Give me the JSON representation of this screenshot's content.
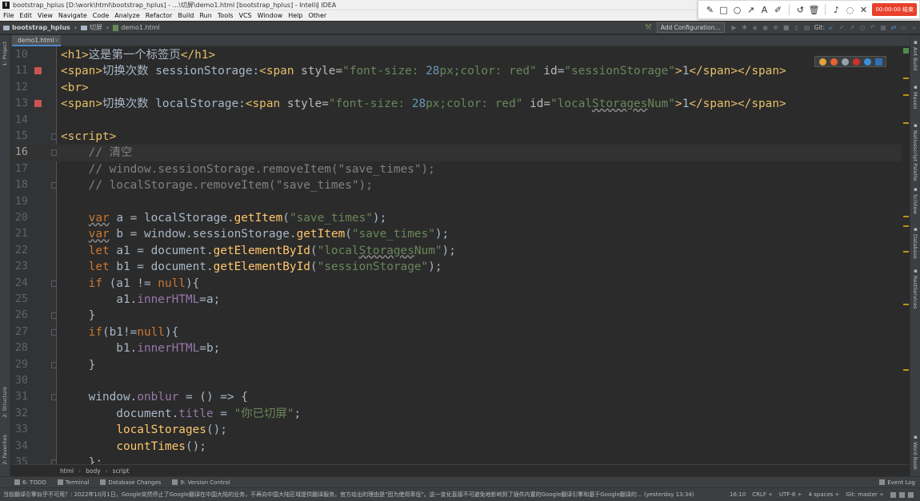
{
  "window": {
    "title": "bootstrap_hplus [D:\\work\\html\\bootstrap_hplus] - ...\\切屏\\demo1.html [bootstrap_hplus] - IntelliJ IDEA"
  },
  "menu": [
    "File",
    "Edit",
    "View",
    "Navigate",
    "Code",
    "Analyze",
    "Refactor",
    "Build",
    "Run",
    "Tools",
    "VCS",
    "Window",
    "Help",
    "Other"
  ],
  "snip_toolbar": {
    "tools": [
      "pen-icon",
      "rectangle-icon",
      "circle-icon",
      "arrow-icon",
      "text-icon",
      "marker-icon",
      "undo-icon",
      "delete-icon",
      "volume-icon",
      "user-icon",
      "close-icon"
    ],
    "record_label": "00:00:00 结束"
  },
  "navbar": {
    "project": "bootstrap_hplus",
    "folder": "切屏",
    "file": "demo1.html",
    "add_config": "Add Configuration...",
    "git_label": "Git:"
  },
  "tabs": [
    {
      "label": "demo1.html"
    }
  ],
  "left_panels": [
    "1: Project",
    "2: Structure",
    "2: Favorites"
  ],
  "right_panels": [
    "Ant Build",
    "Maven",
    "Nativescript Palette",
    "SciView",
    "Database",
    "RestServices",
    "Word Book"
  ],
  "editor": {
    "current_line": 16,
    "lines": [
      {
        "num": "10",
        "bp": false,
        "fold": false,
        "tokens": [
          [
            "tag",
            "<h1>"
          ],
          [
            "txt",
            "这是第一个标签页"
          ],
          [
            "tag",
            "</h1>"
          ]
        ]
      },
      {
        "num": "11",
        "bp": true,
        "fold": false,
        "tokens": [
          [
            "tag",
            "<span>"
          ],
          [
            "txt",
            "切换次数 sessionStorage:"
          ],
          [
            "tag",
            "<span "
          ],
          [
            "attr",
            "style="
          ],
          [
            "val",
            "\"font-size: "
          ],
          [
            "num",
            "28"
          ],
          [
            "val",
            "px;color: red\""
          ],
          [
            "attr",
            " id="
          ],
          [
            "val",
            "\"sessionStorage\""
          ],
          [
            "tag",
            ">"
          ],
          [
            "txt",
            "1"
          ],
          [
            "tag",
            "</span></span>"
          ]
        ]
      },
      {
        "num": "12",
        "bp": false,
        "fold": false,
        "tokens": [
          [
            "tag",
            "<br>"
          ]
        ]
      },
      {
        "num": "13",
        "bp": true,
        "fold": false,
        "tokens": [
          [
            "tag",
            "<span>"
          ],
          [
            "txt",
            "切换次数 localStorage:"
          ],
          [
            "tag",
            "<span "
          ],
          [
            "attr",
            "style="
          ],
          [
            "val",
            "\"font-size: "
          ],
          [
            "num",
            "28"
          ],
          [
            "val",
            "px;color: red\""
          ],
          [
            "attr",
            " id="
          ],
          [
            "val",
            "\"local"
          ],
          [
            "valu",
            "Storages"
          ],
          [
            "val",
            "Num\""
          ],
          [
            "tag",
            ">"
          ],
          [
            "txt",
            "1"
          ],
          [
            "tag",
            "</span></span>"
          ]
        ]
      },
      {
        "num": "14",
        "bp": false,
        "fold": false,
        "tokens": []
      },
      {
        "num": "15",
        "bp": false,
        "fold": true,
        "tokens": [
          [
            "tag",
            "<script>"
          ]
        ]
      },
      {
        "num": "16",
        "bp": false,
        "fold": true,
        "tokens": [
          [
            "txt",
            "    "
          ],
          [
            "cm",
            "// 清空"
          ]
        ]
      },
      {
        "num": "17",
        "bp": false,
        "fold": false,
        "tokens": [
          [
            "txt",
            "    "
          ],
          [
            "cm",
            "// window.sessionStorage.removeItem(\"save_times\");"
          ]
        ]
      },
      {
        "num": "18",
        "bp": false,
        "fold": true,
        "tokens": [
          [
            "txt",
            "    "
          ],
          [
            "cm",
            "// localStorage.removeItem(\"save_times\");"
          ]
        ]
      },
      {
        "num": "19",
        "bp": false,
        "fold": false,
        "tokens": []
      },
      {
        "num": "20",
        "bp": false,
        "fold": false,
        "tokens": [
          [
            "txt",
            "    "
          ],
          [
            "kwu",
            "var"
          ],
          [
            "txt",
            " a = localStorage."
          ],
          [
            "fn",
            "getItem"
          ],
          [
            "txt",
            "("
          ],
          [
            "val",
            "\"save_times\""
          ],
          [
            "txt",
            ");"
          ]
        ]
      },
      {
        "num": "21",
        "bp": false,
        "fold": false,
        "tokens": [
          [
            "txt",
            "    "
          ],
          [
            "kwu",
            "var"
          ],
          [
            "txt",
            " b = window.sessionStorage."
          ],
          [
            "fn",
            "getItem"
          ],
          [
            "txt",
            "("
          ],
          [
            "val",
            "\"save_times\""
          ],
          [
            "txt",
            ");"
          ]
        ]
      },
      {
        "num": "22",
        "bp": false,
        "fold": false,
        "tokens": [
          [
            "txt",
            "    "
          ],
          [
            "kw",
            "let"
          ],
          [
            "txt",
            " a1 = document."
          ],
          [
            "fn",
            "getElementById"
          ],
          [
            "txt",
            "("
          ],
          [
            "val",
            "\"local"
          ],
          [
            "valu",
            "Storages"
          ],
          [
            "val",
            "Num\""
          ],
          [
            "txt",
            ");"
          ]
        ]
      },
      {
        "num": "23",
        "bp": false,
        "fold": false,
        "tokens": [
          [
            "txt",
            "    "
          ],
          [
            "kw",
            "let"
          ],
          [
            "txt",
            " b1 = document."
          ],
          [
            "fn",
            "getElementById"
          ],
          [
            "txt",
            "("
          ],
          [
            "val",
            "\"sessionStorage\""
          ],
          [
            "txt",
            ");"
          ]
        ]
      },
      {
        "num": "24",
        "bp": false,
        "fold": true,
        "tokens": [
          [
            "txt",
            "    "
          ],
          [
            "kw",
            "if"
          ],
          [
            "txt",
            " (a1 != "
          ],
          [
            "kw",
            "null"
          ],
          [
            "txt",
            "){"
          ]
        ]
      },
      {
        "num": "25",
        "bp": false,
        "fold": false,
        "tokens": [
          [
            "txt",
            "        a1."
          ],
          [
            "prop",
            "innerHTML"
          ],
          [
            "txt",
            "=a;"
          ]
        ]
      },
      {
        "num": "26",
        "bp": false,
        "fold": true,
        "tokens": [
          [
            "txt",
            "    }"
          ]
        ]
      },
      {
        "num": "27",
        "bp": false,
        "fold": true,
        "tokens": [
          [
            "txt",
            "    "
          ],
          [
            "kw",
            "if"
          ],
          [
            "txt",
            "(b1!="
          ],
          [
            "kw",
            "null"
          ],
          [
            "txt",
            "){"
          ]
        ]
      },
      {
        "num": "28",
        "bp": false,
        "fold": false,
        "tokens": [
          [
            "txt",
            "        b1."
          ],
          [
            "prop",
            "innerHTML"
          ],
          [
            "txt",
            "=b;"
          ]
        ]
      },
      {
        "num": "29",
        "bp": false,
        "fold": true,
        "tokens": [
          [
            "txt",
            "    }"
          ]
        ]
      },
      {
        "num": "30",
        "bp": false,
        "fold": false,
        "tokens": []
      },
      {
        "num": "31",
        "bp": false,
        "fold": true,
        "tokens": [
          [
            "txt",
            "    window."
          ],
          [
            "prop",
            "onblur"
          ],
          [
            "txt",
            " = () => {"
          ]
        ]
      },
      {
        "num": "32",
        "bp": false,
        "fold": false,
        "tokens": [
          [
            "txt",
            "        document."
          ],
          [
            "prop",
            "title"
          ],
          [
            "txt",
            " = "
          ],
          [
            "val",
            "\"你已切屏\""
          ],
          [
            "txt",
            ";"
          ]
        ]
      },
      {
        "num": "33",
        "bp": false,
        "fold": false,
        "tokens": [
          [
            "txt",
            "        "
          ],
          [
            "fn",
            "localStorages"
          ],
          [
            "txt",
            "();"
          ]
        ]
      },
      {
        "num": "34",
        "bp": false,
        "fold": false,
        "tokens": [
          [
            "txt",
            "        "
          ],
          [
            "fn",
            "countTimes"
          ],
          [
            "txt",
            "();"
          ]
        ]
      },
      {
        "num": "35",
        "bp": false,
        "fold": true,
        "tokens": [
          [
            "txt",
            "    };"
          ]
        ]
      }
    ]
  },
  "breadcrumb": [
    "html",
    "body",
    "script"
  ],
  "tool_windows": [
    "6: TODO",
    "Terminal",
    "Database Changes",
    "9: Version Control"
  ],
  "event_log": "Event Log",
  "status": {
    "message": "当前翻译引擎似乎不可用？: 2022年10月1日，Google突然停止了Google翻译在中国大陆的业务，不再向中国大陆区域提供翻译服务，官方给出的理由是\"因为使用率低\"。这一变化直接不可避免地影响到了插件内置的Google翻译引擎和基于Google翻译的... (yesterday 13:34)",
    "position": "16:10",
    "line_sep": "CRLF ÷",
    "encoding": "UTF-8 ÷",
    "indent": "4 spaces ÷",
    "git": "Git: master ÷"
  },
  "colors": {
    "editor_bg": "#2b2b2b",
    "tag": "#e8bf6a",
    "string": "#6a8759",
    "keyword": "#cc7832",
    "comment": "#808080",
    "function": "#ffc66d",
    "number": "#6897bb",
    "breakpoint": "#c75450"
  }
}
